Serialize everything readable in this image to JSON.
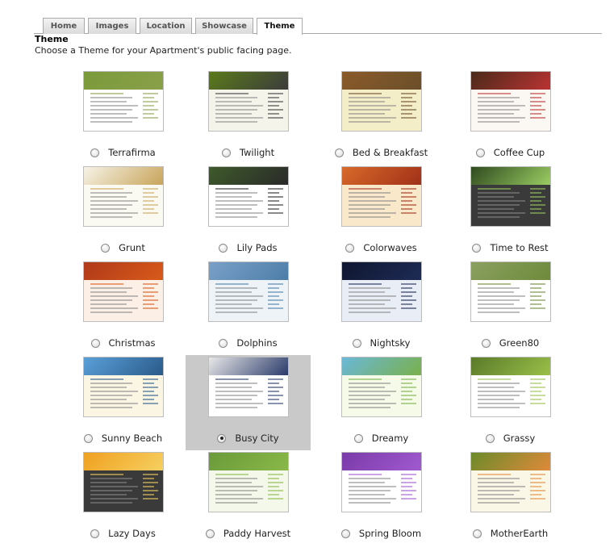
{
  "tabs": [
    {
      "label": "Home",
      "active": false
    },
    {
      "label": "Images",
      "active": false
    },
    {
      "label": "Location",
      "active": false
    },
    {
      "label": "Showcase",
      "active": false
    },
    {
      "label": "Theme",
      "active": true
    }
  ],
  "heading": "Theme",
  "description": "Choose a Theme for your Apartment's public facing page.",
  "selected_theme": "Busy City",
  "themes": [
    {
      "name": "Terrafirma",
      "selected": false,
      "header_color": "#7a9a3a",
      "body_color": "#ffffff",
      "accent": "#8aa04a"
    },
    {
      "name": "Twilight",
      "selected": false,
      "header_color": "#5a7a1a",
      "body_color": "#f4f4ea",
      "accent": "#3c3c3c"
    },
    {
      "name": "Bed & Breakfast",
      "selected": false,
      "header_color": "#8a5a2a",
      "body_color": "#f3eec8",
      "accent": "#6b4f2a"
    },
    {
      "name": "Coffee Cup",
      "selected": false,
      "header_color": "#4a2a1a",
      "body_color": "#fbf8f4",
      "accent": "#b33"
    },
    {
      "name": "Grunt",
      "selected": false,
      "header_color": "#f6f3e6",
      "body_color": "#fbfaf2",
      "accent": "#c8a45a"
    },
    {
      "name": "Lily Pads",
      "selected": false,
      "header_color": "#3e5a2a",
      "body_color": "#ffffff",
      "accent": "#2a2a2a"
    },
    {
      "name": "Colorwaves",
      "selected": false,
      "header_color": "#d86a2a",
      "body_color": "#f9e8c9",
      "accent": "#a03018"
    },
    {
      "name": "Time to Rest",
      "selected": false,
      "header_color": "#2f4a1f",
      "body_color": "#3a3a3a",
      "accent": "#9acd62"
    },
    {
      "name": "Christmas",
      "selected": false,
      "header_color": "#b03a1a",
      "body_color": "#fbefe6",
      "accent": "#d85a1a"
    },
    {
      "name": "Dolphins",
      "selected": false,
      "header_color": "#7aa0c8",
      "body_color": "#eef3f8",
      "accent": "#4d7ea8"
    },
    {
      "name": "Nightsky",
      "selected": false,
      "header_color": "#0f1630",
      "body_color": "#e9eef6",
      "accent": "#1d2b55"
    },
    {
      "name": "Green80",
      "selected": false,
      "header_color": "#8aa060",
      "body_color": "#ffffff",
      "accent": "#6e8a3a"
    },
    {
      "name": "Sunny Beach",
      "selected": false,
      "header_color": "#5aa0d8",
      "body_color": "#fbf6e4",
      "accent": "#2a5a8a"
    },
    {
      "name": "Busy City",
      "selected": true,
      "header_color": "#e8e8e8",
      "body_color": "#ffffff",
      "accent": "#2a3a6a"
    },
    {
      "name": "Dreamy",
      "selected": false,
      "header_color": "#6ab8d8",
      "body_color": "#f6fbe9",
      "accent": "#7ab04a"
    },
    {
      "name": "Grassy",
      "selected": false,
      "header_color": "#5a7a2a",
      "body_color": "#ffffff",
      "accent": "#9ac048"
    },
    {
      "name": "Lazy Days",
      "selected": false,
      "header_color": "#f0a020",
      "body_color": "#3a3a3a",
      "accent": "#f6d060"
    },
    {
      "name": "Paddy Harvest",
      "selected": false,
      "header_color": "#6a9a3a",
      "body_color": "#f4f8ea",
      "accent": "#8ab848"
    },
    {
      "name": "Spring Bloom",
      "selected": false,
      "header_color": "#7a3aa8",
      "body_color": "#ffffff",
      "accent": "#a05ad0"
    },
    {
      "name": "MotherEarth",
      "selected": false,
      "header_color": "#6a8a2a",
      "body_color": "#fbf7e6",
      "accent": "#e08a3a"
    }
  ]
}
